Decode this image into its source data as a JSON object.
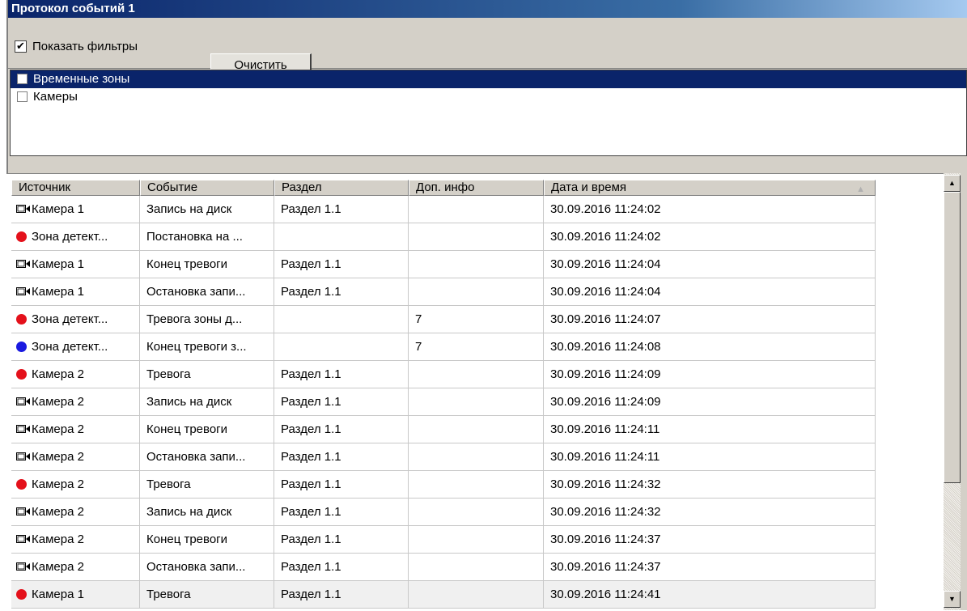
{
  "window": {
    "title": "Протокол событий 1"
  },
  "toolbar": {
    "show_filters_label": "Показать фильтры",
    "show_filters_checked": "✔",
    "clear_label": "Очистить"
  },
  "filters": [
    {
      "label": "Временные зоны",
      "selected": true
    },
    {
      "label": "Камеры",
      "selected": false
    }
  ],
  "colors": {
    "title_bar": "#0a246a",
    "alarm_dot": "#e4111b",
    "end_alarm_dot": "#1a1ae0"
  },
  "grid": {
    "columns": [
      "Источник",
      "Событие",
      "Раздел",
      "Доп. инфо",
      "Дата и время"
    ],
    "sort_indicator": "▲",
    "rows": [
      {
        "icon": "camera-icon",
        "source": "Камера 1",
        "event": "Запись на диск",
        "section": "Раздел 1.1",
        "info": "",
        "datetime": "30.09.2016 11:24:02"
      },
      {
        "icon": "red-dot-icon",
        "source": "Зона детект...",
        "event": "Постановка на ...",
        "section": "",
        "info": "",
        "datetime": "30.09.2016 11:24:02"
      },
      {
        "icon": "camera-icon",
        "source": "Камера 1",
        "event": "Конец тревоги",
        "section": "Раздел 1.1",
        "info": "",
        "datetime": "30.09.2016 11:24:04"
      },
      {
        "icon": "camera-icon",
        "source": "Камера 1",
        "event": "Остановка запи...",
        "section": "Раздел 1.1",
        "info": "",
        "datetime": "30.09.2016 11:24:04"
      },
      {
        "icon": "red-dot-icon",
        "source": "Зона детект...",
        "event": "Тревога зоны д...",
        "section": "",
        "info": "7",
        "datetime": "30.09.2016 11:24:07"
      },
      {
        "icon": "blue-dot-icon",
        "source": "Зона детект...",
        "event": "Конец тревоги з...",
        "section": "",
        "info": "7",
        "datetime": "30.09.2016 11:24:08"
      },
      {
        "icon": "red-dot-icon",
        "source": "Камера 2",
        "event": "Тревога",
        "section": "Раздел 1.1",
        "info": "",
        "datetime": "30.09.2016 11:24:09"
      },
      {
        "icon": "camera-icon",
        "source": "Камера 2",
        "event": "Запись на диск",
        "section": "Раздел 1.1",
        "info": "",
        "datetime": "30.09.2016 11:24:09"
      },
      {
        "icon": "camera-icon",
        "source": "Камера 2",
        "event": "Конец тревоги",
        "section": "Раздел 1.1",
        "info": "",
        "datetime": "30.09.2016 11:24:11"
      },
      {
        "icon": "camera-icon",
        "source": "Камера 2",
        "event": "Остановка запи...",
        "section": "Раздел 1.1",
        "info": "",
        "datetime": "30.09.2016 11:24:11"
      },
      {
        "icon": "red-dot-icon",
        "source": "Камера 2",
        "event": "Тревога",
        "section": "Раздел 1.1",
        "info": "",
        "datetime": "30.09.2016 11:24:32"
      },
      {
        "icon": "camera-icon",
        "source": "Камера 2",
        "event": "Запись на диск",
        "section": "Раздел 1.1",
        "info": "",
        "datetime": "30.09.2016 11:24:32"
      },
      {
        "icon": "camera-icon",
        "source": "Камера 2",
        "event": "Конец тревоги",
        "section": "Раздел 1.1",
        "info": "",
        "datetime": "30.09.2016 11:24:37"
      },
      {
        "icon": "camera-icon",
        "source": "Камера 2",
        "event": "Остановка запи...",
        "section": "Раздел 1.1",
        "info": "",
        "datetime": "30.09.2016 11:24:37"
      },
      {
        "icon": "red-dot-icon",
        "source": "Камера 1",
        "event": "Тревога",
        "section": "Раздел 1.1",
        "info": "",
        "datetime": "30.09.2016 11:24:41"
      }
    ]
  },
  "scrollbar": {
    "up_arrow": "▲",
    "down_arrow": "▼"
  }
}
